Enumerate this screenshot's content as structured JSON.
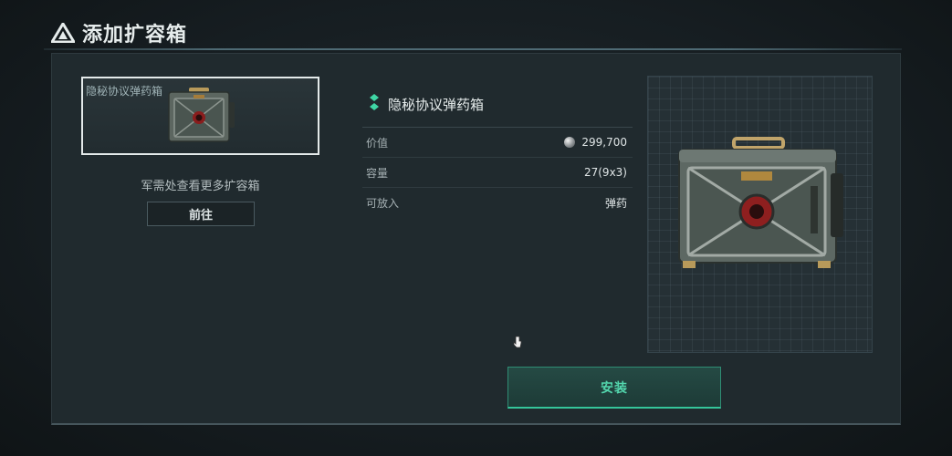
{
  "title": "添加扩容箱",
  "left": {
    "card_label": "隐秘协议弹药箱",
    "hint": "军需处查看更多扩容箱",
    "goto_label": "前往"
  },
  "info": {
    "name": "隐秘协议弹药箱",
    "rows": [
      {
        "label": "价值",
        "value": "299,700",
        "icon": "coin-icon"
      },
      {
        "label": "容量",
        "value": "27(9x3)"
      },
      {
        "label": "可放入",
        "value": "弹药"
      }
    ]
  },
  "install_label": "安装",
  "colors": {
    "accent": "#34c59a",
    "accent_text": "#53d6ad",
    "panel": "#202a2e"
  }
}
